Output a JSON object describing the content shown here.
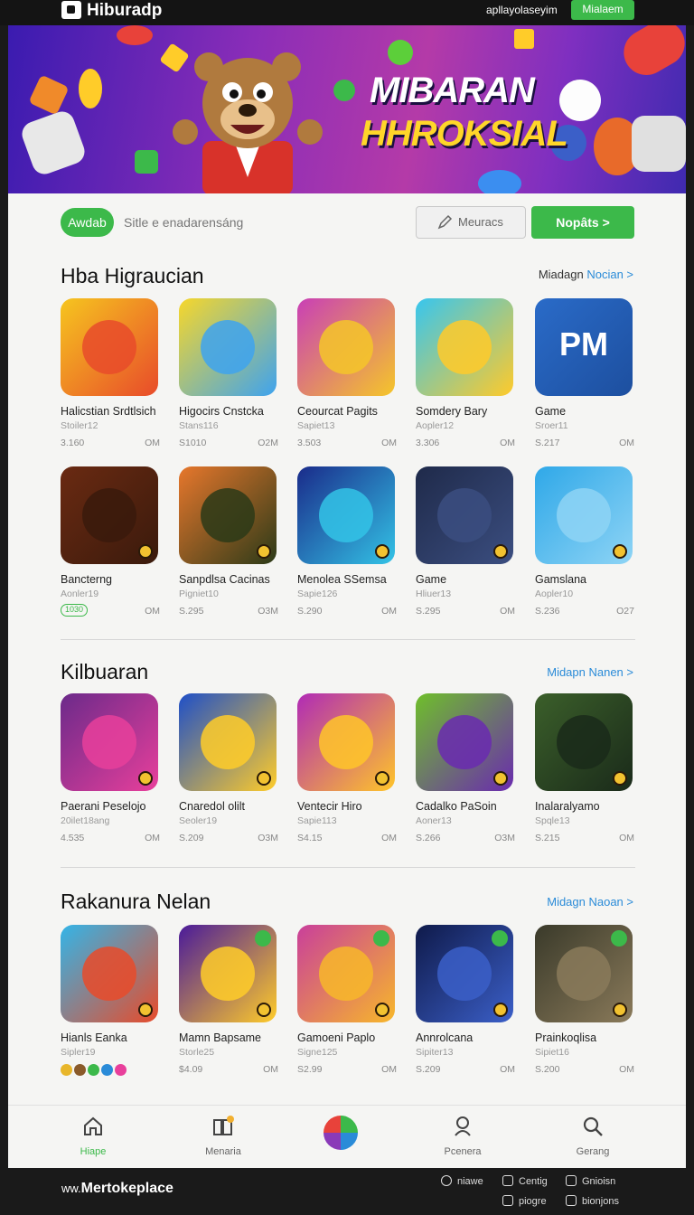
{
  "topbar": {
    "brand": "Hiburadp",
    "link": "apllayolaseyim",
    "button": "Mialaem"
  },
  "hero": {
    "title_line1": "MIBARAN",
    "title_line2": "HHROKSIAL"
  },
  "search": {
    "pill": "Awdab",
    "text": "Sitle e enadarensáng",
    "filter_label": "Meuracs",
    "go_label": "Nopâts >"
  },
  "sections": [
    {
      "title": "Hba Higraucian",
      "link_prefix": "Miadagn",
      "link_main": "Nocian >",
      "apps": [
        {
          "name": "Halicstian Srdtlsich",
          "sub": "Stoiler12",
          "price": "3.160",
          "size": "OM",
          "colors": [
            "#f6c51f",
            "#e84b2a"
          ]
        },
        {
          "name": "Higocirs Cnstcka",
          "sub": "Stans116",
          "price": "S1010",
          "size": "O2M",
          "colors": [
            "#f7d72a",
            "#3ea3ef"
          ]
        },
        {
          "name": "Ceourcat Pagits",
          "sub": "Sapiet13",
          "price": "3.503",
          "size": "OM",
          "colors": [
            "#c93fb6",
            "#f5c629"
          ]
        },
        {
          "name": "Somdery Bary",
          "sub": "Aopler12",
          "price": "3.306",
          "size": "OM",
          "colors": [
            "#37c6ef",
            "#ffca2a"
          ]
        },
        {
          "name": "Game",
          "sub": "Sroer11",
          "price": "S.217",
          "size": "OM",
          "colors": [
            "#2a6bc8",
            "#1d4f9f"
          ],
          "text": "PM"
        }
      ]
    },
    {
      "title": "",
      "apps": [
        {
          "name": "Bancterng",
          "sub": "Aonler19",
          "badge": "1030",
          "size": "OM",
          "colors": [
            "#6a2a12",
            "#3a1a0c"
          ]
        },
        {
          "name": "Sanpdlsa Cacinas",
          "sub": "Pigniet10",
          "price": "S.295",
          "size": "O3M",
          "colors": [
            "#e7772c",
            "#2b3a18"
          ]
        },
        {
          "name": "Menolea SSemsa",
          "sub": "Sapie126",
          "price": "S.290",
          "size": "OM",
          "colors": [
            "#1a2b8a",
            "#33c3e6"
          ]
        },
        {
          "name": "Game",
          "sub": "Hliuer13",
          "price": "S.295",
          "size": "OM",
          "colors": [
            "#1f2a4a",
            "#3b4e80"
          ]
        },
        {
          "name": "Gamslana",
          "sub": "Aopler10",
          "price": "S.236",
          "size": "O27",
          "colors": [
            "#2fa8e8",
            "#8ed4f5"
          ]
        }
      ]
    },
    {
      "title": "Kilbuaran",
      "link_prefix": "",
      "link_main": "Midapn Nanen >",
      "apps": [
        {
          "name": "Paerani Peselojo",
          "sub": "20ilet18ang",
          "price": "4.535",
          "size": "OM",
          "colors": [
            "#6b2a8a",
            "#e83f9b"
          ]
        },
        {
          "name": "Cnaredol olilt",
          "sub": "Seoler19",
          "price": "S.209",
          "size": "O3M",
          "colors": [
            "#1e4fc8",
            "#ffcc29"
          ]
        },
        {
          "name": "Ventecir Hiro",
          "sub": "Sapie113",
          "price": "S4.15",
          "size": "OM",
          "colors": [
            "#b02ab6",
            "#ffc529"
          ]
        },
        {
          "name": "Cadalko PaSoin",
          "sub": "Aoner13",
          "price": "S.266",
          "size": "O3M",
          "colors": [
            "#6fbf2a",
            "#6a2ab0"
          ]
        },
        {
          "name": "Inalaralyamo",
          "sub": "Spqle13",
          "price": "S.215",
          "size": "OM",
          "colors": [
            "#3b5f2a",
            "#1a2a1a"
          ]
        }
      ]
    },
    {
      "title": "Rakanura Nelan",
      "link_prefix": "",
      "link_main": "Midagn Naoan >",
      "apps": [
        {
          "name": "Hianls Eanka",
          "sub": "Sipler19",
          "dots": [
            "#e8b62a",
            "#8a5a2a",
            "#3cb94a",
            "#2a8bd8",
            "#e83f9b"
          ],
          "size": "",
          "colors": [
            "#33b5e8",
            "#e84b2a"
          ]
        },
        {
          "name": "Mamn Bapsame",
          "sub": "Storle25",
          "price": "$4.09",
          "size": "OM",
          "colors": [
            "#4a1a9a",
            "#ffcc29"
          ]
        },
        {
          "name": "Gamoeni Paplo",
          "sub": "Signe125",
          "price": "S2.99",
          "size": "OM",
          "colors": [
            "#c93f9b",
            "#f7b72a"
          ]
        },
        {
          "name": "Annrolcana",
          "sub": "Sipiter13",
          "price": "S.209",
          "size": "OM",
          "colors": [
            "#0f1a4a",
            "#3b5fc8"
          ]
        },
        {
          "name": "Prainkoqlisa",
          "sub": "Sipiet16",
          "price": "S.200",
          "size": "OM",
          "colors": [
            "#3a3a2a",
            "#8a7a5a"
          ]
        }
      ]
    }
  ],
  "bottom_nav": [
    {
      "label": "Hiape",
      "icon": "home-icon",
      "active": true
    },
    {
      "label": "Menaria",
      "icon": "grid-icon",
      "active": false
    },
    {
      "label": "",
      "icon": "pie-icon",
      "active": false
    },
    {
      "label": "Pcenera",
      "icon": "user-icon",
      "active": false
    },
    {
      "label": "Gerang",
      "icon": "search-icon",
      "active": false
    }
  ],
  "footer": {
    "prefix": "ww.",
    "brand": "Mertokeplace",
    "links": [
      "niawe",
      "Centig",
      "Gnioisn",
      "piogre",
      "bionjons"
    ]
  },
  "colors": {
    "accent": "#3cb94a",
    "link": "#2a8bd8"
  }
}
